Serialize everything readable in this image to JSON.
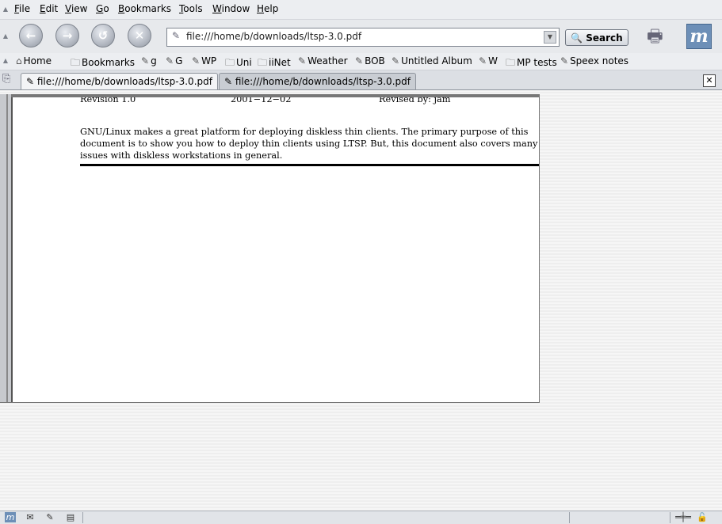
{
  "menu": [
    {
      "key": "F",
      "rest": "ile"
    },
    {
      "key": "E",
      "rest": "dit"
    },
    {
      "key": "V",
      "rest": "iew"
    },
    {
      "key": "G",
      "rest": "o"
    },
    {
      "key": "B",
      "rest": "ookmarks"
    },
    {
      "key": "T",
      "rest": "ools"
    },
    {
      "key": "W",
      "rest": "indow"
    },
    {
      "key": "H",
      "rest": "elp"
    }
  ],
  "nav": {
    "url": "file:///home/b/downloads/ltsp-3.0.pdf",
    "search_label": "Search",
    "icons": {
      "back": "arrow-left-icon",
      "forward": "arrow-right-icon",
      "reload": "reload-icon",
      "stop": "stop-icon",
      "print": "print-icon",
      "logo": "mozilla-m-logo"
    }
  },
  "bookmarks": [
    "Home",
    "Bookmarks",
    "g",
    "G",
    "WP",
    "Uni",
    "iiNet",
    "Weather",
    "BOB",
    "Untitled Album",
    "W",
    "MP tests",
    "Speex notes"
  ],
  "tabs": [
    {
      "title": "file:///home/b/downloads/ltsp-3.0.pdf",
      "active": true
    },
    {
      "title": "file:///home/b/downloads/ltsp-3.0.pdf",
      "active": false
    }
  ],
  "pdf": {
    "revision": "Revision 1.0",
    "date": "2001−12−02",
    "revised_by": "Revised by: jam",
    "paragraph": "GNU/Linux makes a great platform for deploying diskless thin clients. The primary purpose of this document is to show you how to deploy thin clients using LTSP. But, this document also covers many issues with diskless workstations in general."
  },
  "colors": {
    "logo": "#6d8fb7",
    "chrome": "#eceef1"
  }
}
